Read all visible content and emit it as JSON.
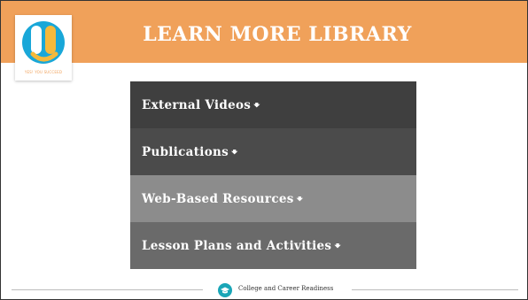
{
  "header": {
    "title": "LEARN MORE LIBRARY",
    "bar_color": "#f0a15a"
  },
  "logo": {
    "icon": "yes-logo-icon",
    "tagline": "YES! YOU SUCCEED",
    "colors": [
      "#19a7d8",
      "#f6b93b",
      "#f0a15a"
    ]
  },
  "menu": {
    "items": [
      {
        "label": "External Videos",
        "arrow": "🡻",
        "bg": "#3f3f3f"
      },
      {
        "label": "Publications",
        "arrow": "🡻",
        "bg": "#4b4b4b"
      },
      {
        "label": "Web-Based Resources",
        "arrow": "🡻",
        "bg": "#8c8c8c"
      },
      {
        "label": "Lesson Plans and Activities",
        "arrow": "🡻",
        "bg": "#6a6a6a"
      }
    ]
  },
  "footer": {
    "icon": "graduation-cap-icon",
    "text": "College and Career Readiness",
    "accent": "#1aa6b7"
  }
}
